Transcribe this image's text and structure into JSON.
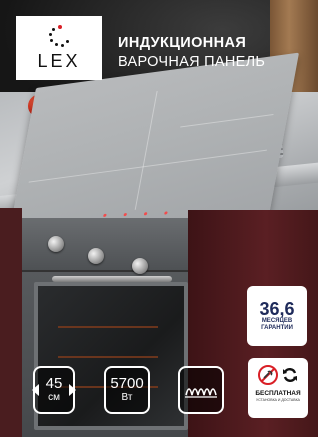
{
  "brand": {
    "name": "LEX"
  },
  "headline": {
    "line1": "ИНДУКЦИОННАЯ",
    "line2": "ВАРОЧНАЯ ПАНЕЛЬ"
  },
  "badges": {
    "warranty": {
      "value": "36,6",
      "line1": "МЕСЯЦЕВ",
      "line2": "ГАРАНТИИ"
    },
    "installation": {
      "title": "БЕСПЛАТНАЯ",
      "subtitle": "УСТАНОВКА И ДОСТАВКА"
    }
  },
  "specs": {
    "width": {
      "value": "45",
      "unit": "см"
    },
    "power": {
      "value": "5700",
      "unit": "Вт"
    },
    "type_icon": "induction-coil-icon"
  },
  "colors": {
    "headline": "#ffffff",
    "warranty_text": "#1e2a5a",
    "background": "#1c1c1c"
  }
}
